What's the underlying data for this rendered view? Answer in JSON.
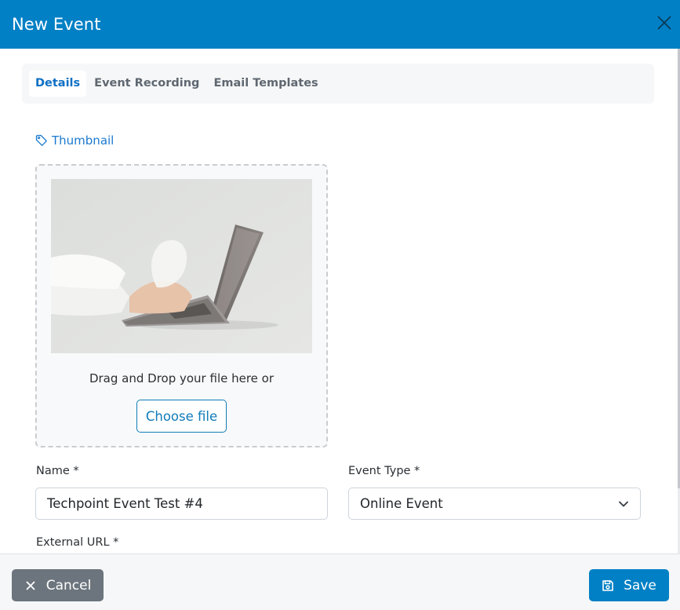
{
  "modal": {
    "title": "New Event",
    "close_icon": "close-icon"
  },
  "tabs": [
    {
      "label": "Details",
      "active": true
    },
    {
      "label": "Event Recording",
      "active": false
    },
    {
      "label": "Email Templates",
      "active": false
    }
  ],
  "thumbnail": {
    "label": "Thumbnail",
    "icon": "tag-icon",
    "drop_text": "Drag and Drop your file here or",
    "choose_label": "Choose file"
  },
  "form": {
    "name_label": "Name *",
    "name_value": "Techpoint Event Test #4",
    "event_type_label": "Event Type *",
    "event_type_value": "Online Event",
    "external_url_label": "External URL *"
  },
  "footer": {
    "cancel_label": "Cancel",
    "save_label": "Save"
  },
  "colors": {
    "brand": "#0180c5",
    "link": "#1a79cf",
    "secondary": "#6c757d"
  }
}
